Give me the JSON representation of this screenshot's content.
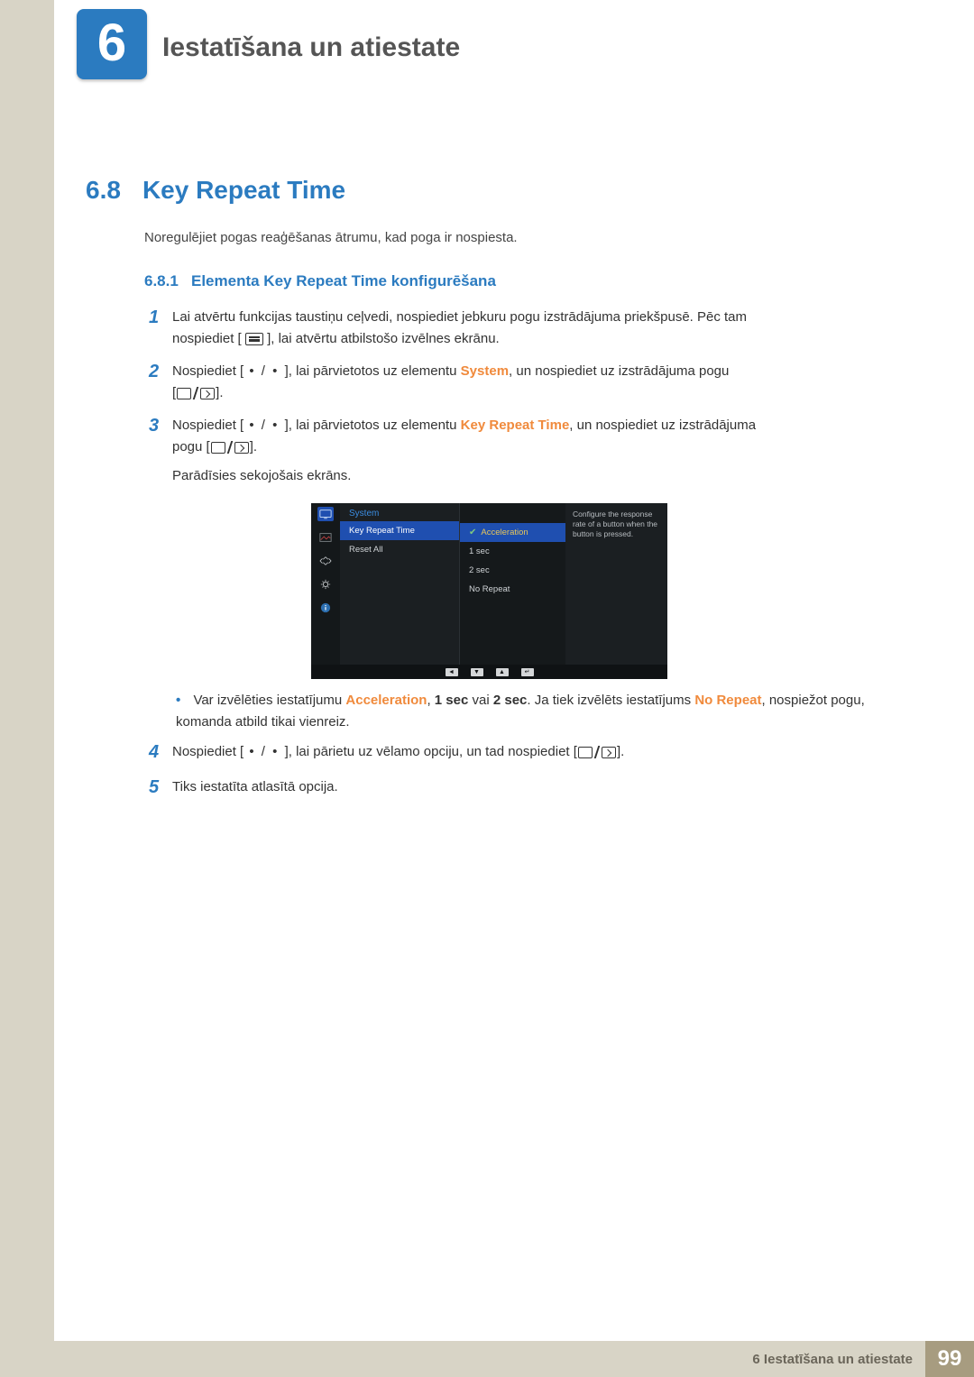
{
  "chapter": {
    "number": "6",
    "title": "Iestatīšana un atiestate"
  },
  "section": {
    "number": "6.8",
    "title": "Key Repeat Time"
  },
  "intro": "Noregulējiet pogas reaģēšanas ātrumu, kad poga ir nospiesta.",
  "subsection": {
    "number": "6.8.1",
    "title": "Elementa Key Repeat Time konfigurēšana"
  },
  "steps": {
    "s1a": "Lai atvērtu funkcijas taustiņu ceļvedi, nospiediet jebkuru pogu izstrādājuma priekšpusē. Pēc tam",
    "s1b_pre": "nospiediet [",
    "s1b_post": "], lai atvērtu atbilstošo izvēlnes ekrānu.",
    "s2_pre": "Nospiediet [",
    "s2_mid": "], lai pārvietotos uz elementu ",
    "s2_target": "System",
    "s2_post": ", un nospiediet uz izstrādājuma pogu",
    "s2_end_pre": "[",
    "s2_end_post": "].",
    "s3_pre": "Nospiediet [",
    "s3_mid": "], lai pārvietotos uz elementu ",
    "s3_target": "Key Repeat Time",
    "s3_post": ", un nospiediet uz izstrādājuma",
    "s3_line2_pre": "pogu [",
    "s3_line2_post": "].",
    "s3_note": "Parādīsies sekojošais ekrāns.",
    "bullet_pre": "Var izvēlēties iestatījumu ",
    "b_accel": "Acceleration",
    "b_comma1": ", ",
    "b_1sec": "1 sec",
    "b_or": " vai ",
    "b_2sec": "2 sec",
    "b_after": ". Ja tiek izvēlēts iestatījums ",
    "b_norepeat": "No Repeat",
    "b_tail": ", nospiežot pogu, komanda atbild tikai vienreiz.",
    "s4_pre": "Nospiediet [",
    "s4_mid": "], lai pārietu uz vēlamo opciju, un tad nospiediet [",
    "s4_post": "].",
    "s5": "Tiks iestatīta atlasītā opcija.",
    "dots": " • / • "
  },
  "osd": {
    "header": "System",
    "menu1": "Key Repeat Time",
    "menu2": "Reset All",
    "opt_sel": "Acceleration",
    "opt2": "1 sec",
    "opt3": "2 sec",
    "opt4": "No Repeat",
    "help": "Configure the response rate of a button when the button is pressed."
  },
  "footer": {
    "text": "6 Iestatīšana un atiestate",
    "page": "99"
  }
}
